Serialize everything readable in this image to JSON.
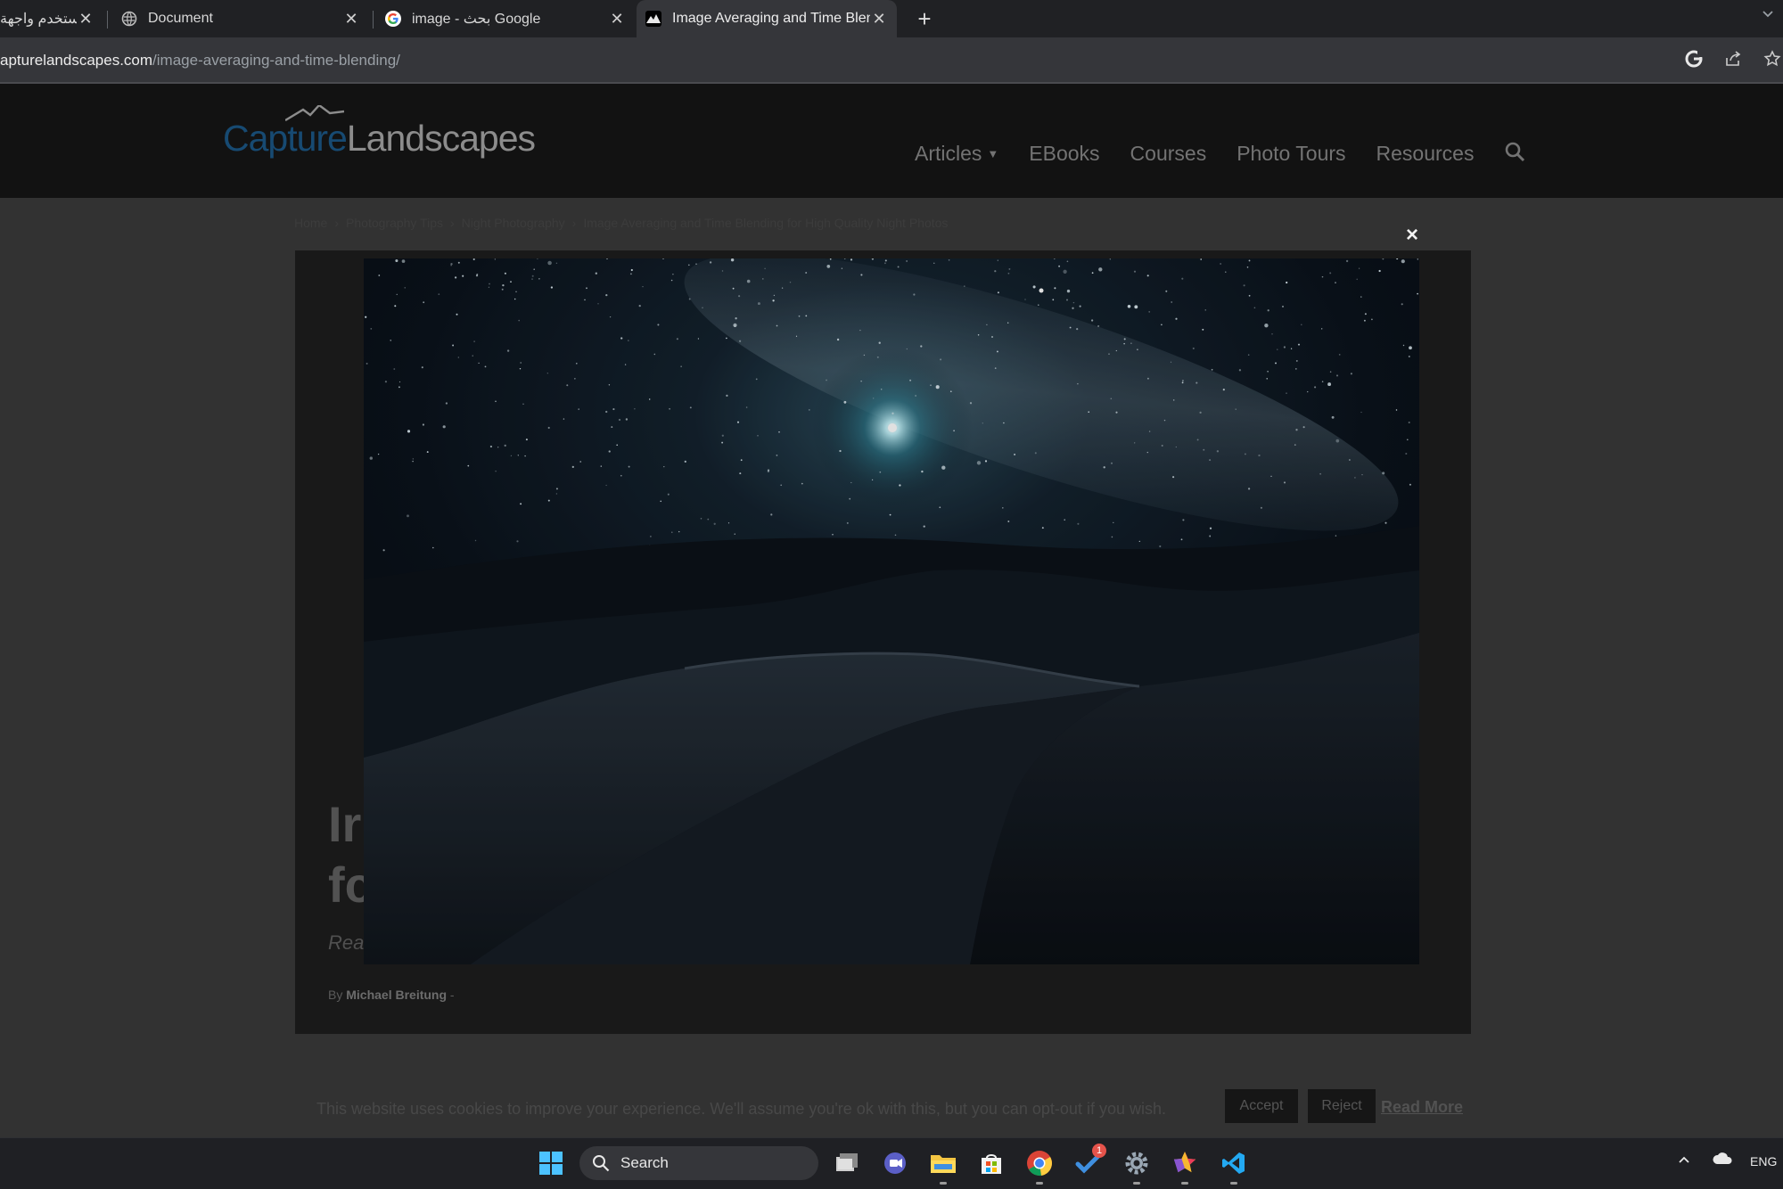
{
  "browser": {
    "tabs": [
      {
        "label": "استخدم واجهة",
        "close": "✕"
      },
      {
        "label": "Document",
        "close": "✕"
      },
      {
        "label": "image - بحث Google",
        "close": "✕"
      },
      {
        "label": "Image Averaging and Time Blen",
        "close": "✕",
        "active": true
      }
    ],
    "new_tab": "+",
    "url_host": "apturelandscapes.com",
    "url_path": "/image-averaging-and-time-blending/"
  },
  "site": {
    "logo_capture": "Capture",
    "logo_landscapes": "Landscapes",
    "nav": [
      {
        "label": "Articles",
        "has_dropdown": true
      },
      {
        "label": "EBooks"
      },
      {
        "label": "Courses"
      },
      {
        "label": "Photo Tours"
      },
      {
        "label": "Resources"
      }
    ]
  },
  "breadcrumb": [
    "Home",
    "Photography Tips",
    "Night Photography",
    "Image Averaging and Time Blending for High Quality Night Photos"
  ],
  "article": {
    "title_line1": "Ir",
    "title_line2": "fc",
    "subtitle": "Rea",
    "by_prefix": "By",
    "author": "Michael Breitung",
    "by_suffix": "-"
  },
  "lightbox": {
    "close_label": "×",
    "image_icon": "night-desert-dunes-milky-way"
  },
  "cookie": {
    "text": "This website uses cookies to improve your experience. We'll assume you're ok with this, but you can opt-out if you wish.",
    "accept": "Accept",
    "reject": "Reject",
    "read_more": "Read More"
  },
  "taskbar": {
    "search_label": "Search",
    "lang": "ENG",
    "todo_badge": "1"
  },
  "colors": {
    "accent_blue": "#174a72",
    "overlay_bg": "#323232"
  }
}
